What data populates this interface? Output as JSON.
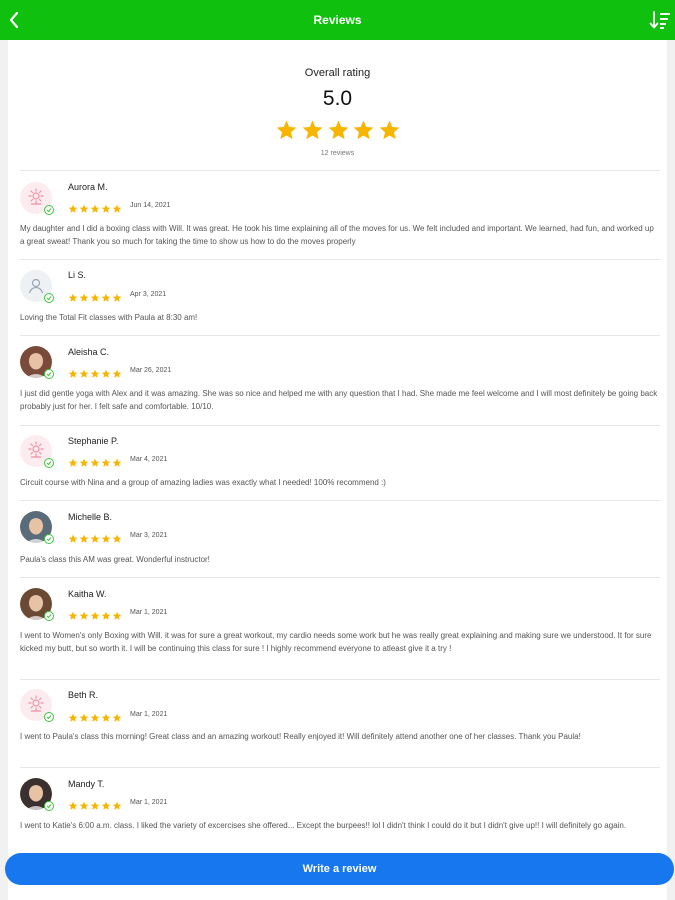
{
  "header": {
    "title": "Reviews",
    "back_icon": "chevron-left-icon",
    "sort_icon": "sort-icon",
    "bg_color": "#0fc00f"
  },
  "overall": {
    "label": "Overall rating",
    "score": "5.0",
    "stars": 5,
    "count_label": "12 reviews",
    "star_color": "#f7b500"
  },
  "reviews": [
    {
      "name": "Aurora M.",
      "rating": 5,
      "date": "Jun 14, 2021",
      "avatar": "default-flower-avatar",
      "text": "My daughter and I did a boxing class with Will. It was great. He took his time explaining all of the moves for us. We felt included and important. We learned, had fun, and worked up a great sweat! Thank you so much for taking the time to show us how to do the moves properly"
    },
    {
      "name": "Li S.",
      "rating": 5,
      "date": "Apr 3, 2021",
      "avatar": "default-person-avatar",
      "text": "Loving the Total Fit classes with Paula at 8:30 am!"
    },
    {
      "name": "Aleisha C.",
      "rating": 5,
      "date": "Mar 26, 2021",
      "avatar": "photo-avatar",
      "text": "I just did gentle yoga with Alex and it was amazing. She was so nice and helped me with any question that I had. She made me feel welcome and I will most definitely be going back probably just for her. I felt safe and comfortable. 10/10."
    },
    {
      "name": "Stephanie P.",
      "rating": 5,
      "date": "Mar 4, 2021",
      "avatar": "default-flower-avatar",
      "text": "Circuit course with Nina and a group of amazing ladies was exactly what I needed! 100% recommend :)"
    },
    {
      "name": "Michelle B.",
      "rating": 5,
      "date": "Mar 3, 2021",
      "avatar": "photo-avatar",
      "text": "Paula's class this AM was great. Wonderful instructor!"
    },
    {
      "name": "Kaitha W.",
      "rating": 5,
      "date": "Mar 1, 2021",
      "avatar": "photo-avatar",
      "text": "I went to Women's only Boxing with Will. it was for sure a great workout, my cardio needs some work but he was really great explaining and making sure we understood. It for sure kicked my butt, but so worth it. I will be continuing this class for sure ! I highly recommend everyone to atleast give it a try !"
    },
    {
      "name": "Beth R.",
      "rating": 5,
      "date": "Mar 1, 2021",
      "avatar": "default-flower-avatar",
      "text": "I went to Paula's class this morning! Great class and an amazing workout! Really enjoyed it! Will definitely attend another one of her classes. Thank you Paula!"
    },
    {
      "name": "Mandy T.",
      "rating": 5,
      "date": "Mar 1, 2021",
      "avatar": "photo-avatar",
      "text": "I went to Katie's 6:00 a.m. class. I liked the variety of excercises she offered... Except the burpees!! lol I didn't think I could do it but I didn't give up!! I will definitely go again."
    }
  ],
  "footer": {
    "write_review_label": "Write a review",
    "button_color": "#1677ee"
  }
}
